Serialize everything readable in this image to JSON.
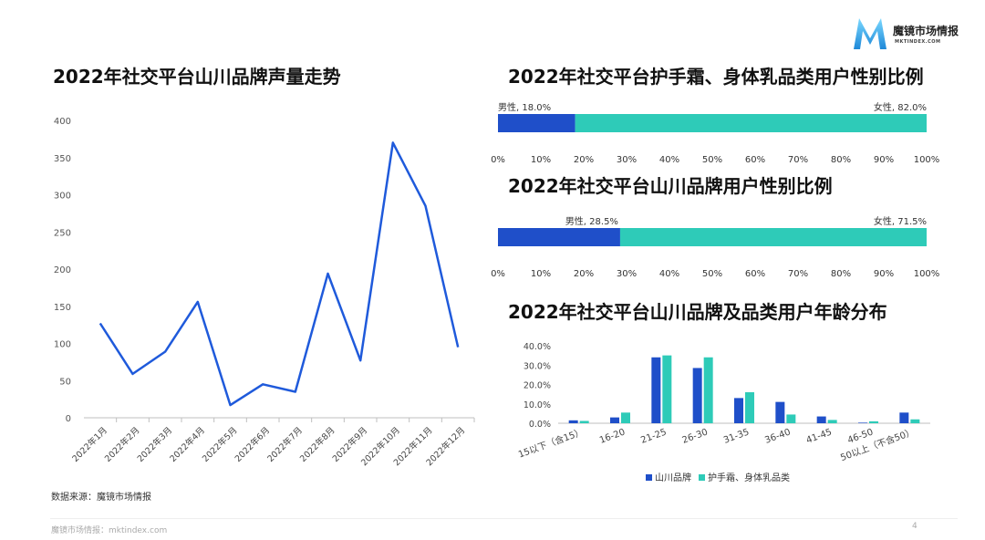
{
  "brand": {
    "name": "魔镜市场情报",
    "sub": "MKTINDEX.COM"
  },
  "colors": {
    "blue": "#1F4FC9",
    "teal": "#2ECBB8",
    "line": "#1F5ADB",
    "axis": "#bfbfbf"
  },
  "source_note": "数据来源：魔镜市场情报",
  "footer": {
    "left": "魔镜市场情报：mktindex.com",
    "page": "4"
  },
  "chart_data": [
    {
      "id": "trend",
      "type": "line",
      "title": "2022年社交平台山川品牌声量走势",
      "categories": [
        "2022年1月",
        "2022年2月",
        "2022年3月",
        "2022年4月",
        "2022年5月",
        "2022年6月",
        "2022年7月",
        "2022年8月",
        "2022年9月",
        "2022年10月",
        "2022年11月",
        "2022年12月"
      ],
      "values": [
        127,
        59,
        89,
        156,
        17,
        45,
        35,
        194,
        77,
        370,
        285,
        95
      ],
      "ylim": [
        0,
        400
      ],
      "yticks": [
        0,
        50,
        100,
        150,
        200,
        250,
        300,
        350,
        400
      ],
      "grid": false
    },
    {
      "id": "gender1",
      "type": "bar",
      "orientation": "horizontal-stacked",
      "title": "2022年社交平台护手霜、身体乳品类用户性别比例",
      "series": [
        {
          "name": "男性",
          "value": 18.0,
          "label": "男性, 18.0%"
        },
        {
          "name": "女性",
          "value": 82.0,
          "label": "女性, 82.0%"
        }
      ],
      "xticks": [
        "0%",
        "10%",
        "20%",
        "30%",
        "40%",
        "50%",
        "60%",
        "70%",
        "80%",
        "90%",
        "100%"
      ]
    },
    {
      "id": "gender2",
      "type": "bar",
      "orientation": "horizontal-stacked",
      "title": "2022年社交平台山川品牌用户性别比例",
      "series": [
        {
          "name": "男性",
          "value": 28.5,
          "label": "男性, 28.5%"
        },
        {
          "name": "女性",
          "value": 71.5,
          "label": "女性, 71.5%"
        }
      ],
      "xticks": [
        "0%",
        "10%",
        "20%",
        "30%",
        "40%",
        "50%",
        "60%",
        "70%",
        "80%",
        "90%",
        "100%"
      ]
    },
    {
      "id": "age",
      "type": "bar",
      "title": "2022年社交平台山川品牌及品类用户年龄分布",
      "categories": [
        "15以下（含15）",
        "16-20",
        "21-25",
        "26-30",
        "31-35",
        "36-40",
        "41-45",
        "46-50",
        "50以上（不含50）"
      ],
      "series": [
        {
          "name": "山川品牌",
          "values": [
            1.5,
            3.0,
            34.0,
            28.5,
            13.0,
            11.0,
            3.5,
            0.3,
            5.5
          ]
        },
        {
          "name": "护手霜、身体乳品类",
          "values": [
            1.2,
            5.5,
            35.0,
            34.0,
            16.0,
            4.5,
            1.7,
            1.0,
            2.0
          ]
        }
      ],
      "ylim": [
        0,
        40
      ],
      "yticks": [
        "0.0%",
        "10.0%",
        "20.0%",
        "30.0%",
        "40.0%"
      ],
      "legend": "bottom"
    }
  ]
}
